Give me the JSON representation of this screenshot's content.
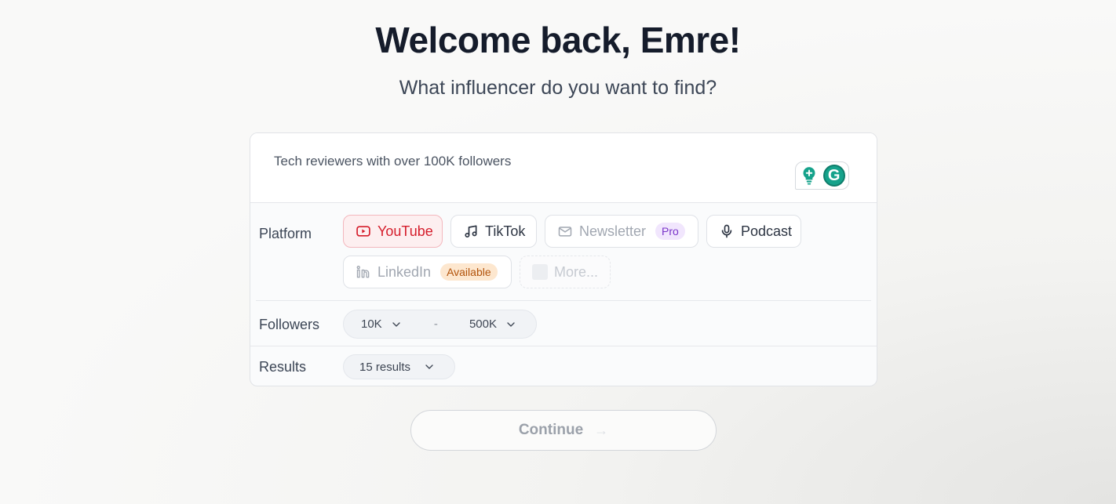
{
  "heading": "Welcome back, Emre!",
  "subheading": "What influencer do you want to find?",
  "query": {
    "value": "Tech reviewers with over 100K followers"
  },
  "platform": {
    "label": "Platform",
    "chips": {
      "youtube": "YouTube",
      "tiktok": "TikTok",
      "newsletter": "Newsletter",
      "newsletter_badge": "Pro",
      "podcast": "Podcast",
      "linkedin": "LinkedIn",
      "linkedin_badge": "Available",
      "more": "More..."
    },
    "selected": "YouTube"
  },
  "followers": {
    "label": "Followers",
    "min": "10K",
    "separator": "-",
    "max": "500K"
  },
  "results": {
    "label": "Results",
    "value": "15 results"
  },
  "continue_label": "Continue",
  "colors": {
    "accent_youtube": "#d51d2b",
    "pro_badge": "#7a35c9",
    "available_badge": "#b2530b",
    "grammarly_green": "#15a28b"
  },
  "icons": [
    "youtube-icon",
    "tiktok-icon",
    "mail-icon",
    "microphone-icon",
    "linkedin-icon",
    "chevron-down-icon",
    "lightbulb-icon",
    "grammarly-icon",
    "arrow-right-icon"
  ]
}
